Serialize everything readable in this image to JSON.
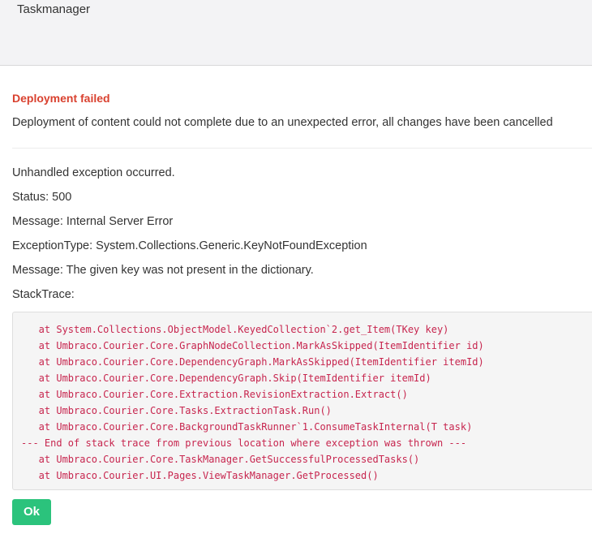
{
  "header": {
    "title": "Taskmanager"
  },
  "error": {
    "title": "Deployment failed",
    "description": "Deployment of content could not complete due to an unexpected error, all changes have been cancelled"
  },
  "details": [
    "Unhandled exception occurred.",
    "Status: 500",
    "Message: Internal Server Error",
    "ExceptionType: System.Collections.Generic.KeyNotFoundException",
    "Message: The given key was not present in the dictionary.",
    "StackTrace:"
  ],
  "stack_trace": [
    "   at System.Collections.ObjectModel.KeyedCollection`2.get_Item(TKey key)",
    "   at Umbraco.Courier.Core.GraphNodeCollection.MarkAsSkipped(ItemIdentifier id)",
    "   at Umbraco.Courier.Core.DependencyGraph.MarkAsSkipped(ItemIdentifier itemId)",
    "   at Umbraco.Courier.Core.DependencyGraph.Skip(ItemIdentifier itemId)",
    "   at Umbraco.Courier.Core.Extraction.RevisionExtraction.Extract()",
    "   at Umbraco.Courier.Core.Tasks.ExtractionTask.Run()",
    "   at Umbraco.Courier.Core.BackgroundTaskRunner`1.ConsumeTaskInternal(T task)",
    "--- End of stack trace from previous location where exception was thrown ---",
    "   at Umbraco.Courier.Core.TaskManager.GetSuccessfulProcessedTasks()",
    "   at Umbraco.Courier.UI.Pages.ViewTaskManager.GetProcessed()"
  ],
  "actions": {
    "ok_label": "Ok"
  },
  "colors": {
    "error_title": "#d9412f",
    "stack_text": "#c7254e",
    "ok_button": "#2bc37c",
    "header_bg": "#f3f3f5"
  }
}
